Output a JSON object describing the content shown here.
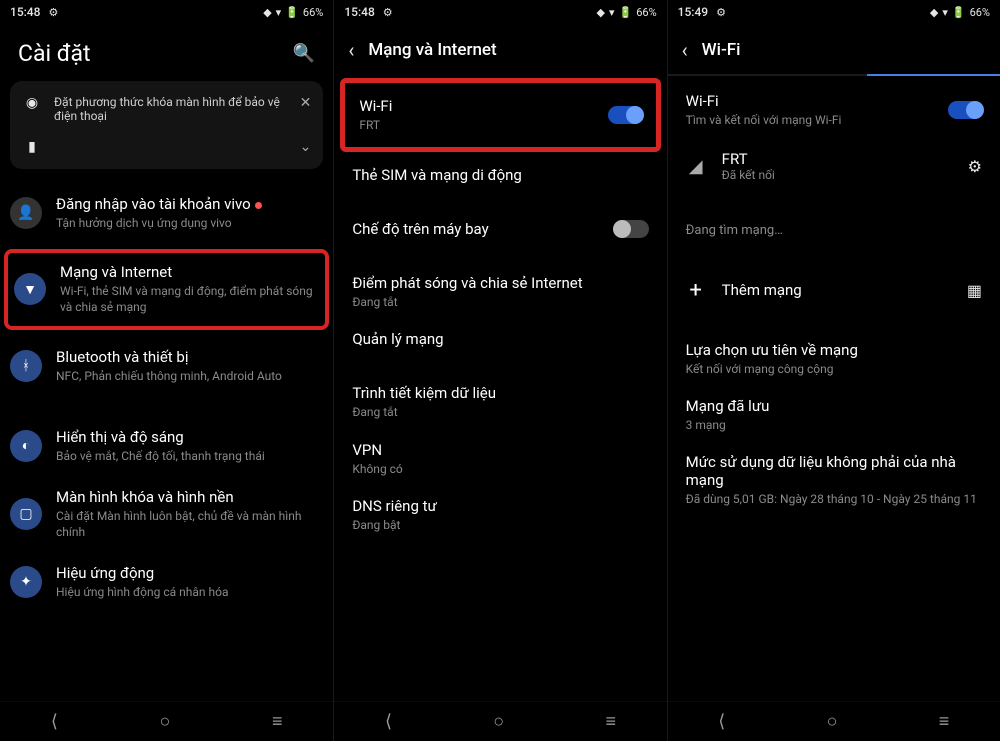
{
  "statusbar": {
    "time1": "15:48",
    "time2": "15:48",
    "time3": "15:49",
    "battery": "66%"
  },
  "screen1": {
    "title": "Cài đặt",
    "card": {
      "lock_msg": "Đặt phương thức khóa màn hình để bảo vệ điện thoại"
    },
    "account": {
      "title": "Đăng nhập vào tài khoản vivo",
      "sub": "Tận hưởng dịch vụ ứng dụng vivo"
    },
    "network": {
      "title": "Mạng và Internet",
      "sub": "Wi-Fi, thẻ SIM và mạng di động, điểm phát sóng và chia sẻ mạng"
    },
    "bt": {
      "title": "Bluetooth và thiết bị",
      "sub": "NFC, Phản chiếu thông minh, Android Auto"
    },
    "display": {
      "title": "Hiển thị và độ sáng",
      "sub": "Bảo vệ mắt, Chế độ tối, thanh trạng thái"
    },
    "lockscreen": {
      "title": "Màn hình khóa và hình nền",
      "sub": "Cài đặt Màn hình luôn bật, chủ đề và màn hình chính"
    },
    "effects": {
      "title": "Hiệu ứng động",
      "sub": "Hiệu ứng hình động cá nhân hóa"
    }
  },
  "screen2": {
    "title": "Mạng và Internet",
    "wifi": {
      "title": "Wi-Fi",
      "sub": "FRT"
    },
    "sim": {
      "title": "Thẻ SIM và mạng di động"
    },
    "airplane": {
      "title": "Chế độ trên máy bay"
    },
    "hotspot": {
      "title": "Điểm phát sóng và chia sẻ Internet",
      "sub": "Đang tắt"
    },
    "manage": {
      "title": "Quản lý mạng"
    },
    "saver": {
      "title": "Trình tiết kiệm dữ liệu",
      "sub": "Đang tắt"
    },
    "vpn": {
      "title": "VPN",
      "sub": "Không có"
    },
    "dns": {
      "title": "DNS riêng tư",
      "sub": "Đang bật"
    }
  },
  "screen3": {
    "title": "Wi-Fi",
    "wifi": {
      "title": "Wi-Fi",
      "sub": "Tìm và kết nối với mạng Wi-Fi"
    },
    "net": {
      "name": "FRT",
      "status": "Đã kết nối"
    },
    "scanning": "Đang tìm mạng…",
    "add": "Thêm mạng",
    "pref": {
      "title": "Lựa chọn ưu tiên về mạng",
      "sub": "Kết nối với mạng công cộng"
    },
    "saved": {
      "title": "Mạng đã lưu",
      "sub": "3 mạng"
    },
    "usage": {
      "title": "Mức sử dụng dữ liệu không phải của nhà mạng",
      "sub": "Đã dùng 5,01 GB: Ngày 28 tháng 10 - Ngày 25 tháng 11"
    }
  }
}
